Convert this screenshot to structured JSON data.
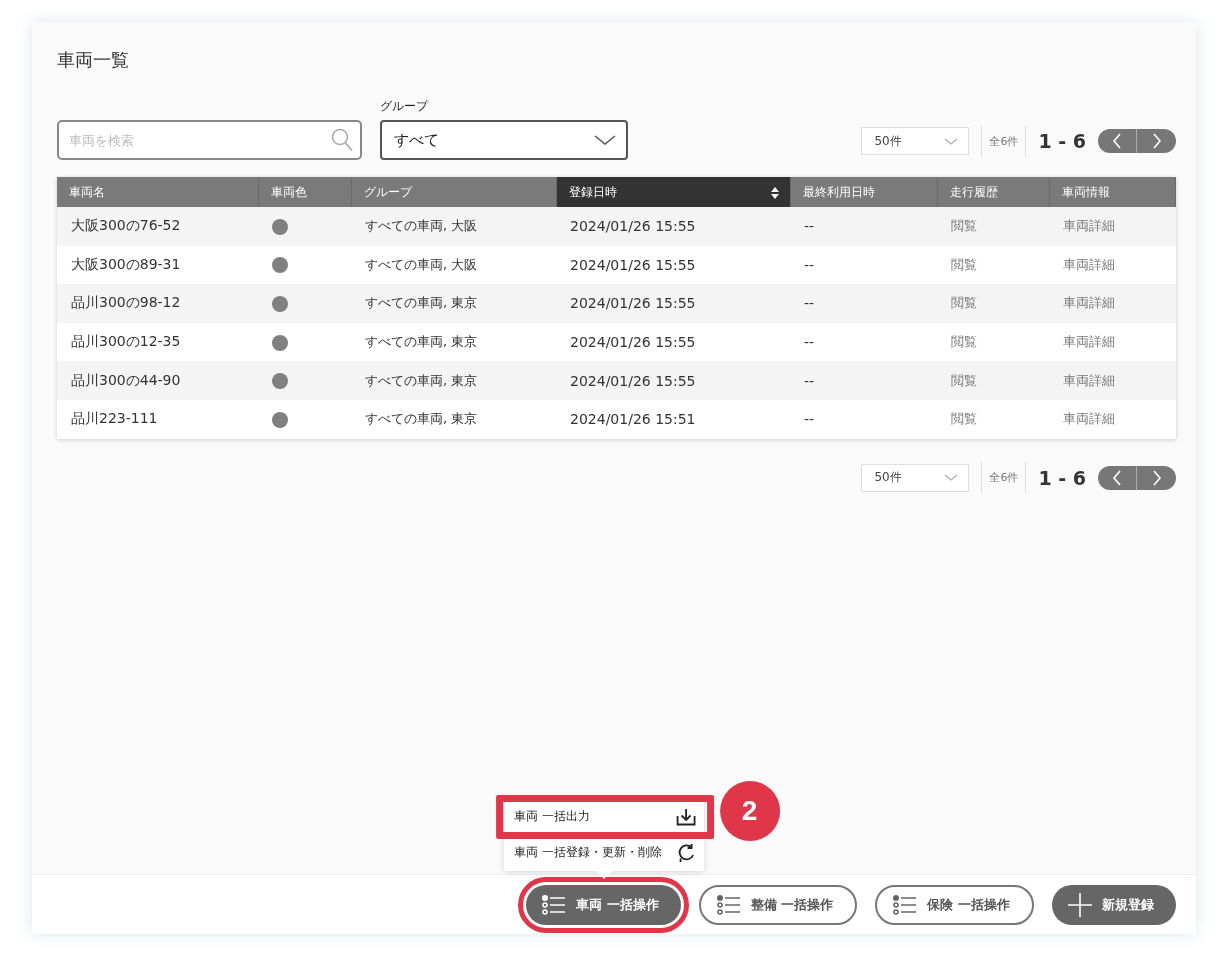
{
  "title": "車両一覧",
  "search": {
    "placeholder": "車両を検索"
  },
  "group_filter": {
    "label": "グループ",
    "value": "すべて"
  },
  "pagination_top": {
    "per_page": "50件",
    "total": "全6件",
    "range": "1 - 6"
  },
  "table": {
    "columns": [
      {
        "label": "車両名",
        "sorted": false
      },
      {
        "label": "車両色",
        "sorted": false
      },
      {
        "label": "グループ",
        "sorted": false
      },
      {
        "label": "登録日時",
        "sorted": true
      },
      {
        "label": "最終利用日時",
        "sorted": false
      },
      {
        "label": "走行履歴",
        "sorted": false
      },
      {
        "label": "車両情報",
        "sorted": false
      }
    ],
    "rows": [
      {
        "name": "大阪300の76-52",
        "color": "#808080",
        "group": "すべての車両, 大阪",
        "registered": "2024/01/26 15:55",
        "last_used": "--",
        "history": "閲覧",
        "info": "車両詳細"
      },
      {
        "name": "大阪300の89-31",
        "color": "#808080",
        "group": "すべての車両, 大阪",
        "registered": "2024/01/26 15:55",
        "last_used": "--",
        "history": "閲覧",
        "info": "車両詳細"
      },
      {
        "name": "品川300の98-12",
        "color": "#808080",
        "group": "すべての車両, 東京",
        "registered": "2024/01/26 15:55",
        "last_used": "--",
        "history": "閲覧",
        "info": "車両詳細"
      },
      {
        "name": "品川300の12-35",
        "color": "#808080",
        "group": "すべての車両, 東京",
        "registered": "2024/01/26 15:55",
        "last_used": "--",
        "history": "閲覧",
        "info": "車両詳細"
      },
      {
        "name": "品川300の44-90",
        "color": "#808080",
        "group": "すべての車両, 東京",
        "registered": "2024/01/26 15:55",
        "last_used": "--",
        "history": "閲覧",
        "info": "車両詳細"
      },
      {
        "name": "品川223-111",
        "color": "#808080",
        "group": "すべての車両, 東京",
        "registered": "2024/01/26 15:51",
        "last_used": "--",
        "history": "閲覧",
        "info": "車両詳細"
      }
    ]
  },
  "pagination_bottom": {
    "per_page": "50件",
    "total": "全6件",
    "range": "1 - 6"
  },
  "popup_menu": {
    "items": [
      {
        "label": "車両 一括出力",
        "annotated": true
      },
      {
        "label": "車両 一括登録・更新・削除",
        "annotated": false
      }
    ],
    "annotation": "2"
  },
  "footer_buttons": [
    {
      "label": "車両 一括操作",
      "kind": "bulk",
      "annotated": true,
      "menu_open": true
    },
    {
      "label": "整備 一括操作",
      "kind": "bulk",
      "annotated": false,
      "menu_open": false
    },
    {
      "label": "保険 一括操作",
      "kind": "bulk",
      "annotated": false,
      "menu_open": false
    },
    {
      "label": "新規登録",
      "kind": "new",
      "annotated": false,
      "menu_open": false
    }
  ]
}
